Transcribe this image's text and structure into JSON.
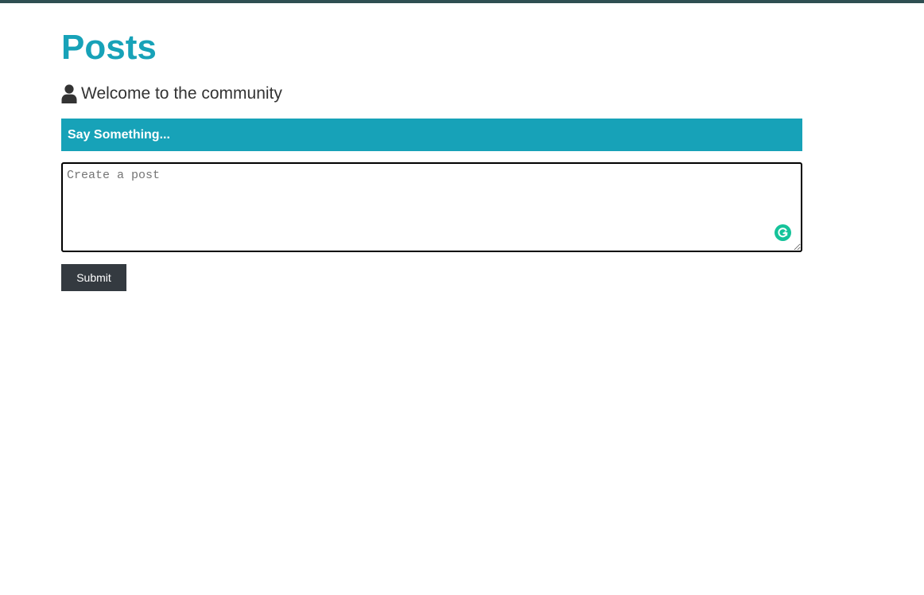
{
  "page": {
    "title": "Posts",
    "welcome_text": "Welcome to the community",
    "user_icon": "user-icon",
    "accent_color": "#17a2b8",
    "top_bar_color": "#2f4f52"
  },
  "post_form": {
    "header": "Say Something...",
    "textarea_placeholder": "Create a post",
    "textarea_value": "",
    "grammar_icon": "grammarly-icon",
    "grammar_icon_color": "#15c39a",
    "submit_label": "Submit",
    "submit_color": "#343a40"
  }
}
